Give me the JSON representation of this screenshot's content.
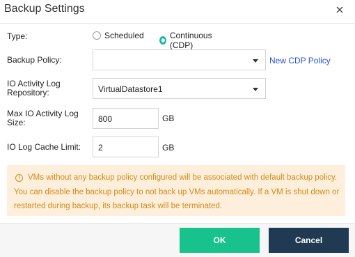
{
  "dialog": {
    "title": "Backup Settings",
    "close_icon": "close-icon"
  },
  "form": {
    "type_label": "Type:",
    "type_options": [
      {
        "label": "Scheduled",
        "checked": false
      },
      {
        "label": "Continuous (CDP)",
        "checked": true
      }
    ],
    "backup_policy_label": "Backup Policy:",
    "backup_policy_value": "",
    "new_policy_link": "New CDP Policy",
    "io_repo_label_line1": "IO Activity Log",
    "io_repo_label_line2": "Repository:",
    "io_repo_value": "VirtualDatastore1",
    "max_size_label_line1": "Max IO Activity Log",
    "max_size_label_line2": "Size:",
    "max_size_value": "800",
    "max_size_unit": "GB",
    "cache_label": "IO Log Cache Limit:",
    "cache_value": "2",
    "cache_unit": "GB"
  },
  "notice": {
    "icon": "info-icon",
    "text": "VMs without any backup policy configured will be associated with default backup policy. You can disable the backup policy to not back up VMs automatically. If a VM is shut down or restarted during backup, its backup task will be terminated."
  },
  "footer": {
    "ok_label": "OK",
    "cancel_label": "Cancel"
  },
  "colors": {
    "accent": "#14b9a8",
    "ok_button": "#18c28c",
    "cancel_button": "#1f3a52",
    "notice_bg": "#fdefdc",
    "notice_text": "#d58a17",
    "link": "#2456d6"
  }
}
